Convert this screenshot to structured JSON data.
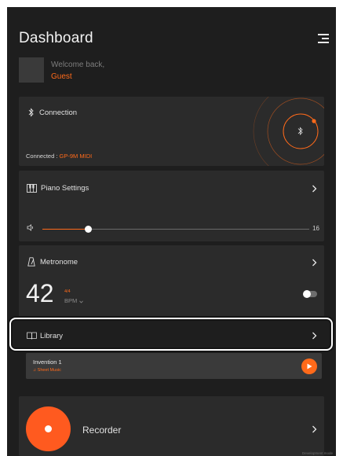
{
  "app": {
    "title": "Dashboard"
  },
  "user": {
    "welcome": "Welcome back,",
    "name": "Guest"
  },
  "connection": {
    "label": "Connection",
    "status_prefix": "Connected : ",
    "device": "GP-9M MIDI"
  },
  "piano_settings": {
    "label": "Piano Settings",
    "volume_value": "16",
    "volume_level": 0.17
  },
  "metronome": {
    "label": "Metronome",
    "bpm": "42",
    "time_signature": "4/4",
    "bpm_unit": "BPM",
    "enabled": false
  },
  "library": {
    "label": "Library",
    "song": {
      "title": "Invention 1",
      "type": "Sheet Music"
    }
  },
  "recorder": {
    "label": "Recorder"
  },
  "footer": {
    "note": "Development mode"
  },
  "colors": {
    "accent": "#ff6a1a",
    "background": "#1e1e1e",
    "card": "#2b2b2b"
  },
  "icons": [
    "menu-icon",
    "bluetooth-icon",
    "piano-icon",
    "volume-icon",
    "metronome-icon",
    "book-icon",
    "music-note-icon",
    "play-icon",
    "record-icon",
    "chevron-right-icon"
  ]
}
